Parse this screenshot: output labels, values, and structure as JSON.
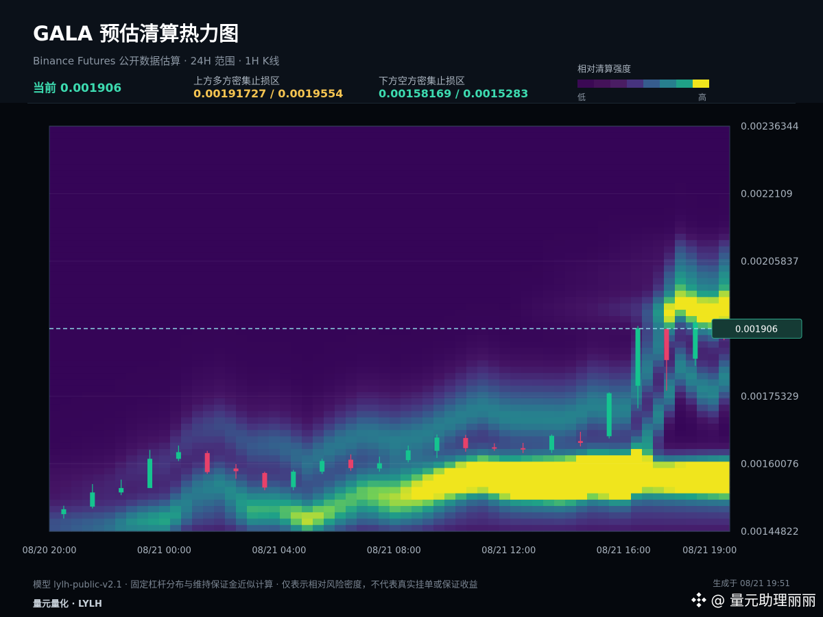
{
  "header": {
    "title": "GALA 预估清算热力图",
    "subtitle": "Binance Futures 公开数据估算 · 24H 范围 · 1H K线",
    "current_label": "当前 0.001906",
    "upper_zone_label": "上方多方密集止损区",
    "upper_zone_value": "0.00191727 / 0.0019554",
    "lower_zone_label": "下方空方密集止损区",
    "lower_zone_value": "0.00158169 / 0.0015283"
  },
  "legend": {
    "title": "相对清算强度",
    "low": "低",
    "high": "高",
    "colors": [
      "#3b0954",
      "#441259",
      "#4a1d63",
      "#46337e",
      "#365c8d",
      "#277f8e",
      "#1fa187",
      "#f0e51d"
    ]
  },
  "colors": {
    "current": "#3ddbb0",
    "upper_zone": "#f5c451",
    "lower_zone": "#3ddbb0",
    "candle_up": "#15c48f",
    "candle_down": "#e8416a",
    "current_line": "#8fd6e6"
  },
  "chart_data": {
    "type": "heatmap",
    "y_ticks": [
      "0.00236344",
      "0.0022109",
      "0.00205837",
      "0.00175329",
      "0.00160076",
      "0.00144822"
    ],
    "x_ticks": [
      "08/20 20:00",
      "08/21 00:00",
      "08/21 04:00",
      "08/21 08:00",
      "08/21 12:00",
      "08/21 16:00",
      "08/21 19:00"
    ],
    "x_range_hours": [
      0,
      23.7
    ],
    "y_range": [
      0.00144822,
      0.00236344
    ],
    "current_price": 0.001906,
    "current_price_label": "0.001906",
    "candles": [
      {
        "h": 0.5,
        "o": 0.001487,
        "c": 0.001498,
        "hi": 0.001506,
        "lo": 0.001477
      },
      {
        "h": 1.5,
        "o": 0.001504,
        "c": 0.001536,
        "hi": 0.001555,
        "lo": 0.0015
      },
      {
        "h": 2.5,
        "o": 0.001536,
        "c": 0.001546,
        "hi": 0.001565,
        "lo": 0.00153
      },
      {
        "h": 3.5,
        "o": 0.001546,
        "c": 0.001612,
        "hi": 0.001632,
        "lo": 0.001546
      },
      {
        "h": 4.5,
        "o": 0.001612,
        "c": 0.001627,
        "hi": 0.001642,
        "lo": 0.001607
      },
      {
        "h": 5.5,
        "o": 0.001625,
        "c": 0.001582,
        "hi": 0.00163,
        "lo": 0.001578
      },
      {
        "h": 6.5,
        "o": 0.00159,
        "c": 0.001584,
        "hi": 0.0016,
        "lo": 0.001567
      },
      {
        "h": 7.5,
        "o": 0.00158,
        "c": 0.001547,
        "hi": 0.001583,
        "lo": 0.001541
      },
      {
        "h": 8.5,
        "o": 0.001548,
        "c": 0.001583,
        "hi": 0.001587,
        "lo": 0.001541
      },
      {
        "h": 9.5,
        "o": 0.001583,
        "c": 0.001607,
        "hi": 0.001612,
        "lo": 0.001578
      },
      {
        "h": 10.5,
        "o": 0.00161,
        "c": 0.001591,
        "hi": 0.001622,
        "lo": 0.001585
      },
      {
        "h": 11.5,
        "o": 0.00159,
        "c": 0.001602,
        "hi": 0.001617,
        "lo": 0.001583
      },
      {
        "h": 12.5,
        "o": 0.001609,
        "c": 0.001631,
        "hi": 0.001642,
        "lo": 0.001604
      },
      {
        "h": 13.5,
        "o": 0.00163,
        "c": 0.00166,
        "hi": 0.001667,
        "lo": 0.001614
      },
      {
        "h": 14.5,
        "o": 0.001659,
        "c": 0.001636,
        "hi": 0.001666,
        "lo": 0.001628
      },
      {
        "h": 15.5,
        "o": 0.001638,
        "c": 0.001635,
        "hi": 0.001647,
        "lo": 0.00163
      },
      {
        "h": 16.5,
        "o": 0.001636,
        "c": 0.001633,
        "hi": 0.001648,
        "lo": 0.001625
      },
      {
        "h": 17.5,
        "o": 0.001632,
        "c": 0.001664,
        "hi": 0.001667,
        "lo": 0.001625
      },
      {
        "h": 18.5,
        "o": 0.001652,
        "c": 0.001648,
        "hi": 0.001673,
        "lo": 0.00164
      },
      {
        "h": 19.5,
        "o": 0.001663,
        "c": 0.00176,
        "hi": 0.001762,
        "lo": 0.001658
      },
      {
        "h": 20.5,
        "o": 0.001777,
        "c": 0.001907,
        "hi": 0.001912,
        "lo": 0.001726
      },
      {
        "h": 21.5,
        "o": 0.001905,
        "c": 0.001835,
        "hi": 0.001907,
        "lo": 0.001766
      },
      {
        "h": 22.5,
        "o": 0.001838,
        "c": 0.00192,
        "hi": 0.001924,
        "lo": 0.001822
      },
      {
        "h": 23.5,
        "o": 0.001905,
        "c": 0.0019,
        "hi": 0.001918,
        "lo": 0.00188
      }
    ]
  },
  "footer": {
    "note": "模型 lylh-public-v2.1 · 固定杠杆分布与维持保证金近似计算 · 仅表示相对风险密度，不代表真实挂单或保证收益",
    "brand": "量元量化 · LYLH",
    "generated": "生成于 08/21 19:51",
    "watermark": "@ 量元助理丽丽"
  }
}
